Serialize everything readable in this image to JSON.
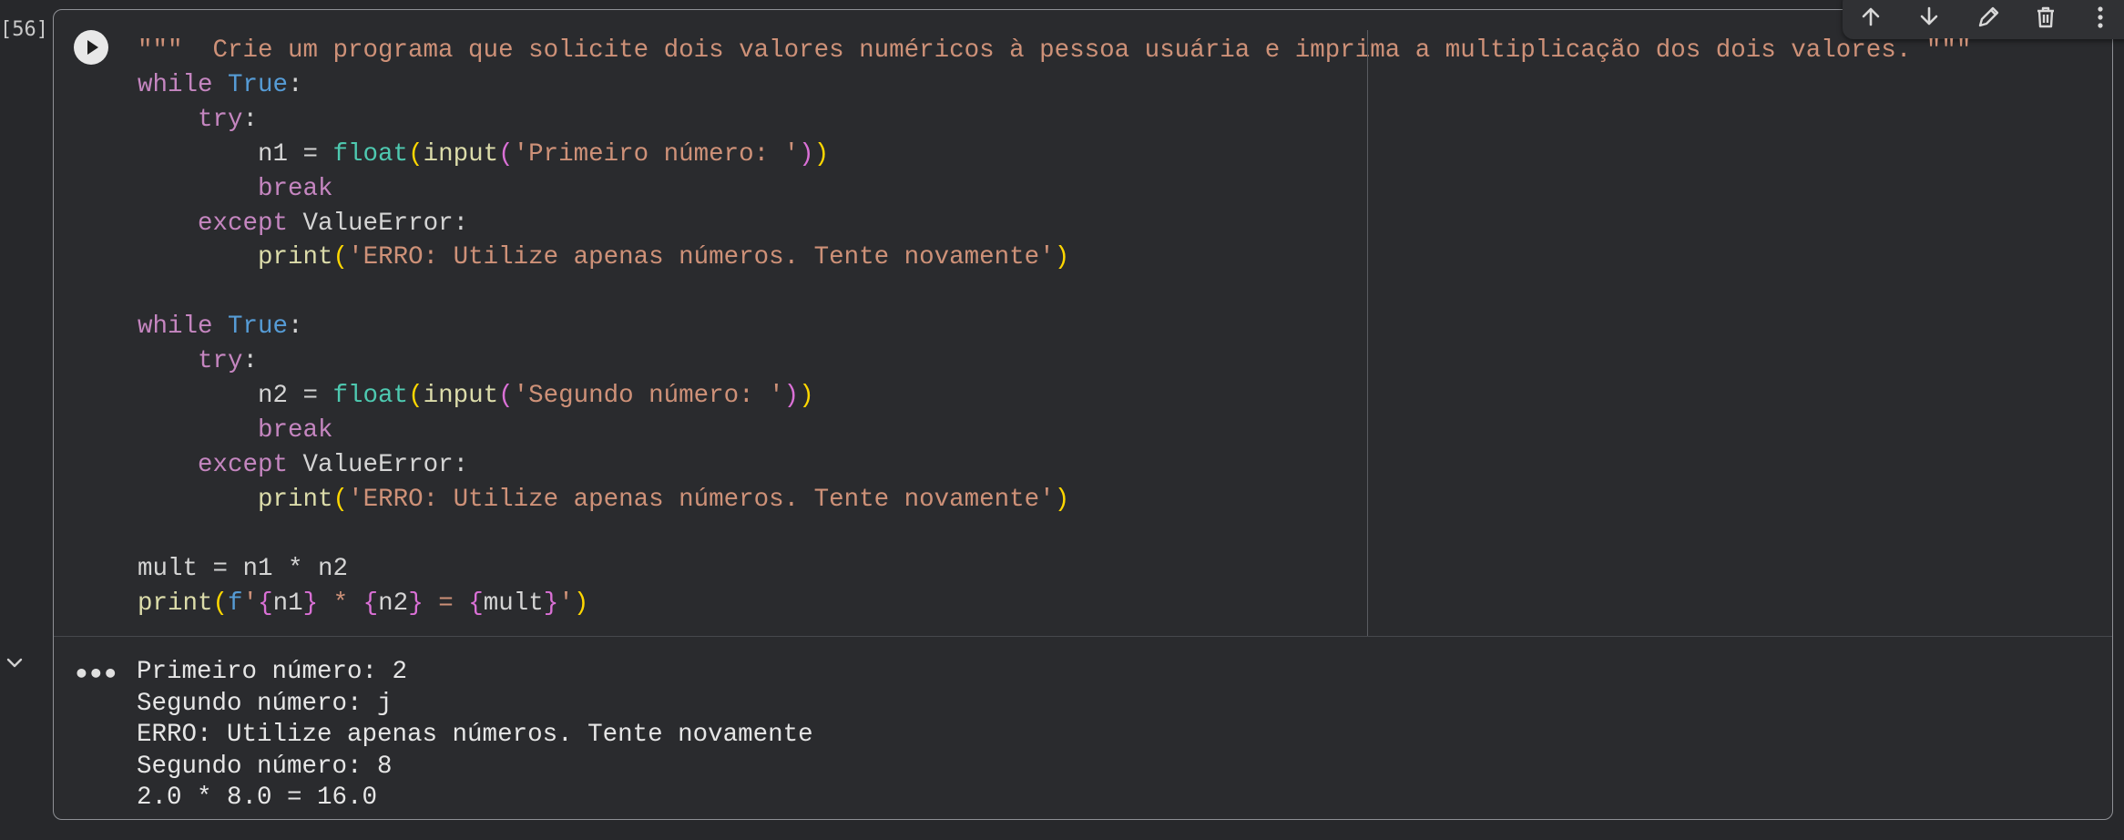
{
  "cell": {
    "execution_count": "[56]",
    "code_lines": [
      "\"\"\"  Crie um programa que solicite dois valores numéricos à pessoa usuária e imprima a multiplicação dos dois valores. \"\"\"",
      "while True:",
      "    try:",
      "        n1 = float(input('Primeiro número: '))",
      "        break",
      "    except ValueError:",
      "        print('ERRO: Utilize apenas números. Tente novamente')",
      "",
      "while True:",
      "    try:",
      "        n2 = float(input('Segundo número: '))",
      "        break",
      "    except ValueError:",
      "        print('ERRO: Utilize apenas números. Tente novamente')",
      "",
      "mult = n1 * n2",
      "print(f'{n1} * {n2} = {mult}')"
    ],
    "output_lines": [
      "Primeiro número: 2",
      "Segundo número: j",
      "ERRO: Utilize apenas números. Tente novamente",
      "Segundo número: 8",
      "2.0 * 8.0 = 16.0"
    ],
    "output_menu_label": "•••"
  },
  "icons": {
    "run": "play-circle-icon",
    "collapse": "chevron-down-icon",
    "toolbar": [
      "arrow-up-icon",
      "arrow-down-icon",
      "pencil-icon",
      "trash-icon",
      "more-vert-icon"
    ]
  },
  "colors": {
    "background": "#27282b",
    "keyword": "#c586c0",
    "builtin_constant": "#569cd6",
    "function": "#dcdcaa",
    "type": "#4ec9b0",
    "string": "#ce9178",
    "bracket_level1": "#ffd700",
    "bracket_level2": "#da70d6",
    "cell_border": "#8f9196"
  }
}
